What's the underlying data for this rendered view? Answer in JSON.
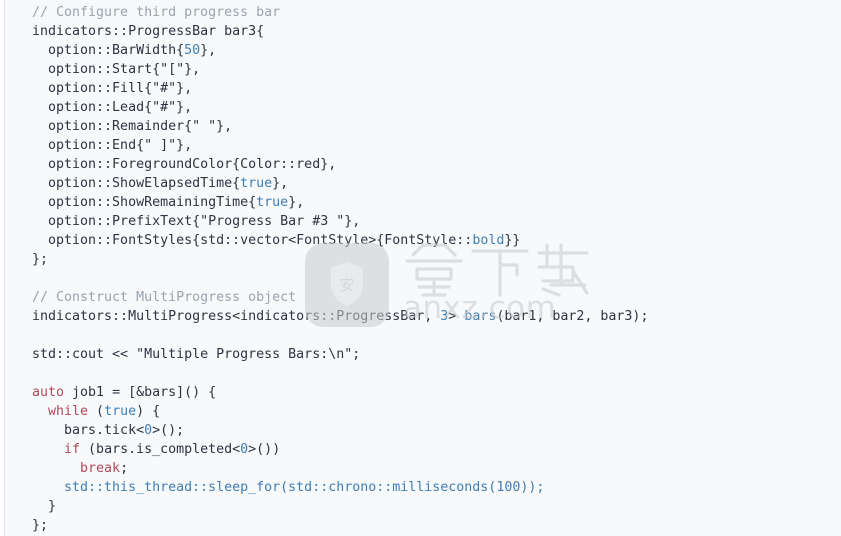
{
  "document": {
    "kind": "code-listing",
    "language": "C++",
    "background_color": "#f7f9fb",
    "text_color": "#2e3440",
    "comment_color": "#9aa4ae",
    "keyword_color": "#b04a5a",
    "literal_color": "#3f7fb5"
  },
  "code": {
    "lines": [
      {
        "indent": 0,
        "tokens": [
          {
            "t": "// Configure third progress bar",
            "c": "cm"
          }
        ]
      },
      {
        "indent": 0,
        "tokens": [
          {
            "t": "indicators::ProgressBar bar3{",
            "c": "pl"
          }
        ]
      },
      {
        "indent": 1,
        "tokens": [
          {
            "t": "option::BarWidth{",
            "c": "pl"
          },
          {
            "t": "50",
            "c": "num"
          },
          {
            "t": "},",
            "c": "pl"
          }
        ]
      },
      {
        "indent": 1,
        "tokens": [
          {
            "t": "option::Start{\"[\"},",
            "c": "pl"
          }
        ]
      },
      {
        "indent": 1,
        "tokens": [
          {
            "t": "option::Fill{\"#\"},",
            "c": "pl"
          }
        ]
      },
      {
        "indent": 1,
        "tokens": [
          {
            "t": "option::Lead{\"#\"},",
            "c": "pl"
          }
        ]
      },
      {
        "indent": 1,
        "tokens": [
          {
            "t": "option::Remainder{\" \"},",
            "c": "pl"
          }
        ]
      },
      {
        "indent": 1,
        "tokens": [
          {
            "t": "option::End{\" ]\"},",
            "c": "pl"
          }
        ]
      },
      {
        "indent": 1,
        "tokens": [
          {
            "t": "option::ForegroundColor{Color::red},",
            "c": "pl"
          }
        ]
      },
      {
        "indent": 1,
        "tokens": [
          {
            "t": "option::ShowElapsedTime{",
            "c": "pl"
          },
          {
            "t": "true",
            "c": "num"
          },
          {
            "t": "},",
            "c": "pl"
          }
        ]
      },
      {
        "indent": 1,
        "tokens": [
          {
            "t": "option::ShowRemainingTime{",
            "c": "pl"
          },
          {
            "t": "true",
            "c": "num"
          },
          {
            "t": "},",
            "c": "pl"
          }
        ]
      },
      {
        "indent": 1,
        "tokens": [
          {
            "t": "option::PrefixText{\"Progress Bar #3 \"},",
            "c": "pl"
          }
        ]
      },
      {
        "indent": 1,
        "tokens": [
          {
            "t": "option::FontStyles{std::vector<FontStyle>{FontStyle::",
            "c": "pl"
          },
          {
            "t": "bold",
            "c": "num"
          },
          {
            "t": "}}",
            "c": "pl"
          }
        ]
      },
      {
        "indent": 0,
        "tokens": [
          {
            "t": "};",
            "c": "pl"
          }
        ]
      },
      {
        "indent": 0,
        "tokens": []
      },
      {
        "indent": 0,
        "tokens": [
          {
            "t": "// Construct MultiProgress object",
            "c": "cm"
          }
        ]
      },
      {
        "indent": 0,
        "tokens": [
          {
            "t": "indicators::MultiProgress<indicators::ProgressBar, ",
            "c": "pl"
          },
          {
            "t": "3",
            "c": "num"
          },
          {
            "t": "> ",
            "c": "pl"
          },
          {
            "t": "bars",
            "c": "fn"
          },
          {
            "t": "(bar1, bar2, bar3);",
            "c": "pl"
          }
        ]
      },
      {
        "indent": 0,
        "tokens": []
      },
      {
        "indent": 0,
        "tokens": [
          {
            "t": "std::cout << \"Multiple Progress Bars:\\n\";",
            "c": "pl"
          }
        ]
      },
      {
        "indent": 0,
        "tokens": []
      },
      {
        "indent": 0,
        "tokens": [
          {
            "t": "auto",
            "c": "kw"
          },
          {
            "t": " job1 = [&bars]() {",
            "c": "pl"
          }
        ]
      },
      {
        "indent": 1,
        "tokens": [
          {
            "t": "while",
            "c": "kw"
          },
          {
            "t": " (",
            "c": "pl"
          },
          {
            "t": "true",
            "c": "num"
          },
          {
            "t": ") {",
            "c": "pl"
          }
        ]
      },
      {
        "indent": 2,
        "tokens": [
          {
            "t": "bars.tick<",
            "c": "pl"
          },
          {
            "t": "0",
            "c": "num"
          },
          {
            "t": ">();",
            "c": "pl"
          }
        ]
      },
      {
        "indent": 2,
        "tokens": [
          {
            "t": "if",
            "c": "kw"
          },
          {
            "t": " (bars.is_completed<",
            "c": "pl"
          },
          {
            "t": "0",
            "c": "num"
          },
          {
            "t": ">())",
            "c": "pl"
          }
        ]
      },
      {
        "indent": 3,
        "tokens": [
          {
            "t": "break",
            "c": "kw"
          },
          {
            "t": ";",
            "c": "pl"
          }
        ]
      },
      {
        "indent": 2,
        "tokens": [
          {
            "t": "std::this_thread::sleep_for(std::chrono::milliseconds(100));",
            "c": "fn"
          }
        ]
      },
      {
        "indent": 1,
        "tokens": [
          {
            "t": "}",
            "c": "pl"
          }
        ]
      },
      {
        "indent": 0,
        "tokens": [
          {
            "t": "};",
            "c": "pl"
          }
        ]
      }
    ]
  },
  "watermark": {
    "site_url": "anxz.com",
    "badge_character": "安",
    "outline_text": "安下载",
    "badge_color": "#c9cbcd",
    "text_color": "#c7c9cb"
  }
}
